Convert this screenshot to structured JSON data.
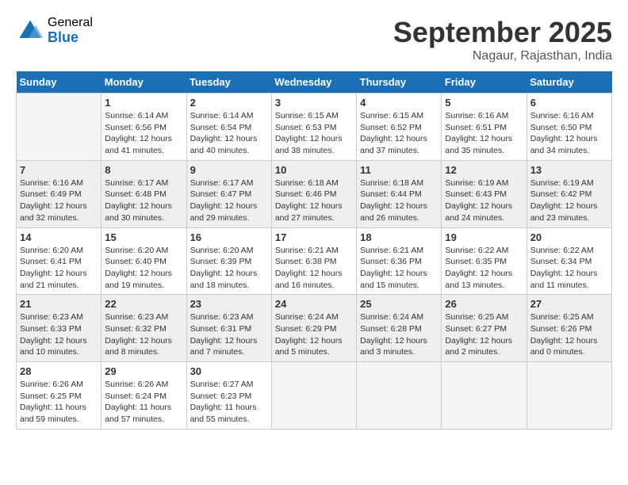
{
  "logo": {
    "general": "General",
    "blue": "Blue"
  },
  "header": {
    "month": "September 2025",
    "location": "Nagaur, Rajasthan, India"
  },
  "weekdays": [
    "Sunday",
    "Monday",
    "Tuesday",
    "Wednesday",
    "Thursday",
    "Friday",
    "Saturday"
  ],
  "weeks": [
    [
      {
        "day": "",
        "info": ""
      },
      {
        "day": "1",
        "info": "Sunrise: 6:14 AM\nSunset: 6:56 PM\nDaylight: 12 hours\nand 41 minutes."
      },
      {
        "day": "2",
        "info": "Sunrise: 6:14 AM\nSunset: 6:54 PM\nDaylight: 12 hours\nand 40 minutes."
      },
      {
        "day": "3",
        "info": "Sunrise: 6:15 AM\nSunset: 6:53 PM\nDaylight: 12 hours\nand 38 minutes."
      },
      {
        "day": "4",
        "info": "Sunrise: 6:15 AM\nSunset: 6:52 PM\nDaylight: 12 hours\nand 37 minutes."
      },
      {
        "day": "5",
        "info": "Sunrise: 6:16 AM\nSunset: 6:51 PM\nDaylight: 12 hours\nand 35 minutes."
      },
      {
        "day": "6",
        "info": "Sunrise: 6:16 AM\nSunset: 6:50 PM\nDaylight: 12 hours\nand 34 minutes."
      }
    ],
    [
      {
        "day": "7",
        "info": "Sunrise: 6:16 AM\nSunset: 6:49 PM\nDaylight: 12 hours\nand 32 minutes."
      },
      {
        "day": "8",
        "info": "Sunrise: 6:17 AM\nSunset: 6:48 PM\nDaylight: 12 hours\nand 30 minutes."
      },
      {
        "day": "9",
        "info": "Sunrise: 6:17 AM\nSunset: 6:47 PM\nDaylight: 12 hours\nand 29 minutes."
      },
      {
        "day": "10",
        "info": "Sunrise: 6:18 AM\nSunset: 6:46 PM\nDaylight: 12 hours\nand 27 minutes."
      },
      {
        "day": "11",
        "info": "Sunrise: 6:18 AM\nSunset: 6:44 PM\nDaylight: 12 hours\nand 26 minutes."
      },
      {
        "day": "12",
        "info": "Sunrise: 6:19 AM\nSunset: 6:43 PM\nDaylight: 12 hours\nand 24 minutes."
      },
      {
        "day": "13",
        "info": "Sunrise: 6:19 AM\nSunset: 6:42 PM\nDaylight: 12 hours\nand 23 minutes."
      }
    ],
    [
      {
        "day": "14",
        "info": "Sunrise: 6:20 AM\nSunset: 6:41 PM\nDaylight: 12 hours\nand 21 minutes."
      },
      {
        "day": "15",
        "info": "Sunrise: 6:20 AM\nSunset: 6:40 PM\nDaylight: 12 hours\nand 19 minutes."
      },
      {
        "day": "16",
        "info": "Sunrise: 6:20 AM\nSunset: 6:39 PM\nDaylight: 12 hours\nand 18 minutes."
      },
      {
        "day": "17",
        "info": "Sunrise: 6:21 AM\nSunset: 6:38 PM\nDaylight: 12 hours\nand 16 minutes."
      },
      {
        "day": "18",
        "info": "Sunrise: 6:21 AM\nSunset: 6:36 PM\nDaylight: 12 hours\nand 15 minutes."
      },
      {
        "day": "19",
        "info": "Sunrise: 6:22 AM\nSunset: 6:35 PM\nDaylight: 12 hours\nand 13 minutes."
      },
      {
        "day": "20",
        "info": "Sunrise: 6:22 AM\nSunset: 6:34 PM\nDaylight: 12 hours\nand 11 minutes."
      }
    ],
    [
      {
        "day": "21",
        "info": "Sunrise: 6:23 AM\nSunset: 6:33 PM\nDaylight: 12 hours\nand 10 minutes."
      },
      {
        "day": "22",
        "info": "Sunrise: 6:23 AM\nSunset: 6:32 PM\nDaylight: 12 hours\nand 8 minutes."
      },
      {
        "day": "23",
        "info": "Sunrise: 6:23 AM\nSunset: 6:31 PM\nDaylight: 12 hours\nand 7 minutes."
      },
      {
        "day": "24",
        "info": "Sunrise: 6:24 AM\nSunset: 6:29 PM\nDaylight: 12 hours\nand 5 minutes."
      },
      {
        "day": "25",
        "info": "Sunrise: 6:24 AM\nSunset: 6:28 PM\nDaylight: 12 hours\nand 3 minutes."
      },
      {
        "day": "26",
        "info": "Sunrise: 6:25 AM\nSunset: 6:27 PM\nDaylight: 12 hours\nand 2 minutes."
      },
      {
        "day": "27",
        "info": "Sunrise: 6:25 AM\nSunset: 6:26 PM\nDaylight: 12 hours\nand 0 minutes."
      }
    ],
    [
      {
        "day": "28",
        "info": "Sunrise: 6:26 AM\nSunset: 6:25 PM\nDaylight: 11 hours\nand 59 minutes."
      },
      {
        "day": "29",
        "info": "Sunrise: 6:26 AM\nSunset: 6:24 PM\nDaylight: 11 hours\nand 57 minutes."
      },
      {
        "day": "30",
        "info": "Sunrise: 6:27 AM\nSunset: 6:23 PM\nDaylight: 11 hours\nand 55 minutes."
      },
      {
        "day": "",
        "info": ""
      },
      {
        "day": "",
        "info": ""
      },
      {
        "day": "",
        "info": ""
      },
      {
        "day": "",
        "info": ""
      }
    ]
  ]
}
